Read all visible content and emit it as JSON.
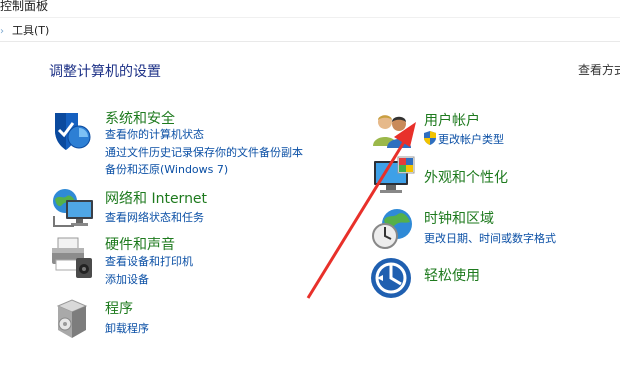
{
  "breadcrumb": {
    "text": "控制面板",
    "separator": "›"
  },
  "menubar": {
    "tools": "工具(T)"
  },
  "header": {
    "title": "调整计算机的设置",
    "view_by": "查看方式"
  },
  "categories": {
    "system_security": {
      "title": "系统和安全",
      "links": [
        "查看你的计算机状态",
        "通过文件历史记录保存你的文件备份副本",
        "备份和还原(Windows 7)"
      ],
      "icon": "shield-icon"
    },
    "network": {
      "title": "网络和 Internet",
      "links": [
        "查看网络状态和任务"
      ],
      "icon": "network-globe-icon"
    },
    "hardware": {
      "title": "硬件和声音",
      "links": [
        "查看设备和打印机",
        "添加设备"
      ],
      "icon": "printer-icon"
    },
    "programs": {
      "title": "程序",
      "links": [
        "卸载程序"
      ],
      "icon": "programs-box-icon"
    },
    "user_accounts": {
      "title": "用户帐户",
      "links": [
        "更改帐户类型"
      ],
      "icon": "users-icon"
    },
    "appearance": {
      "title": "外观和个性化",
      "links": [],
      "icon": "monitor-palette-icon"
    },
    "clock_region": {
      "title": "时钟和区域",
      "links": [
        "更改日期、时间或数字格式"
      ],
      "icon": "clock-globe-icon"
    },
    "ease_access": {
      "title": "轻松使用",
      "links": [],
      "icon": "ease-of-access-icon"
    }
  },
  "colors": {
    "category_title": "#1e7a1e",
    "link": "#0a4fa5",
    "page_title": "#1e3287",
    "annotation_arrow": "#e8302a"
  },
  "annotation": {
    "type": "arrow",
    "target": "用户帐户"
  }
}
